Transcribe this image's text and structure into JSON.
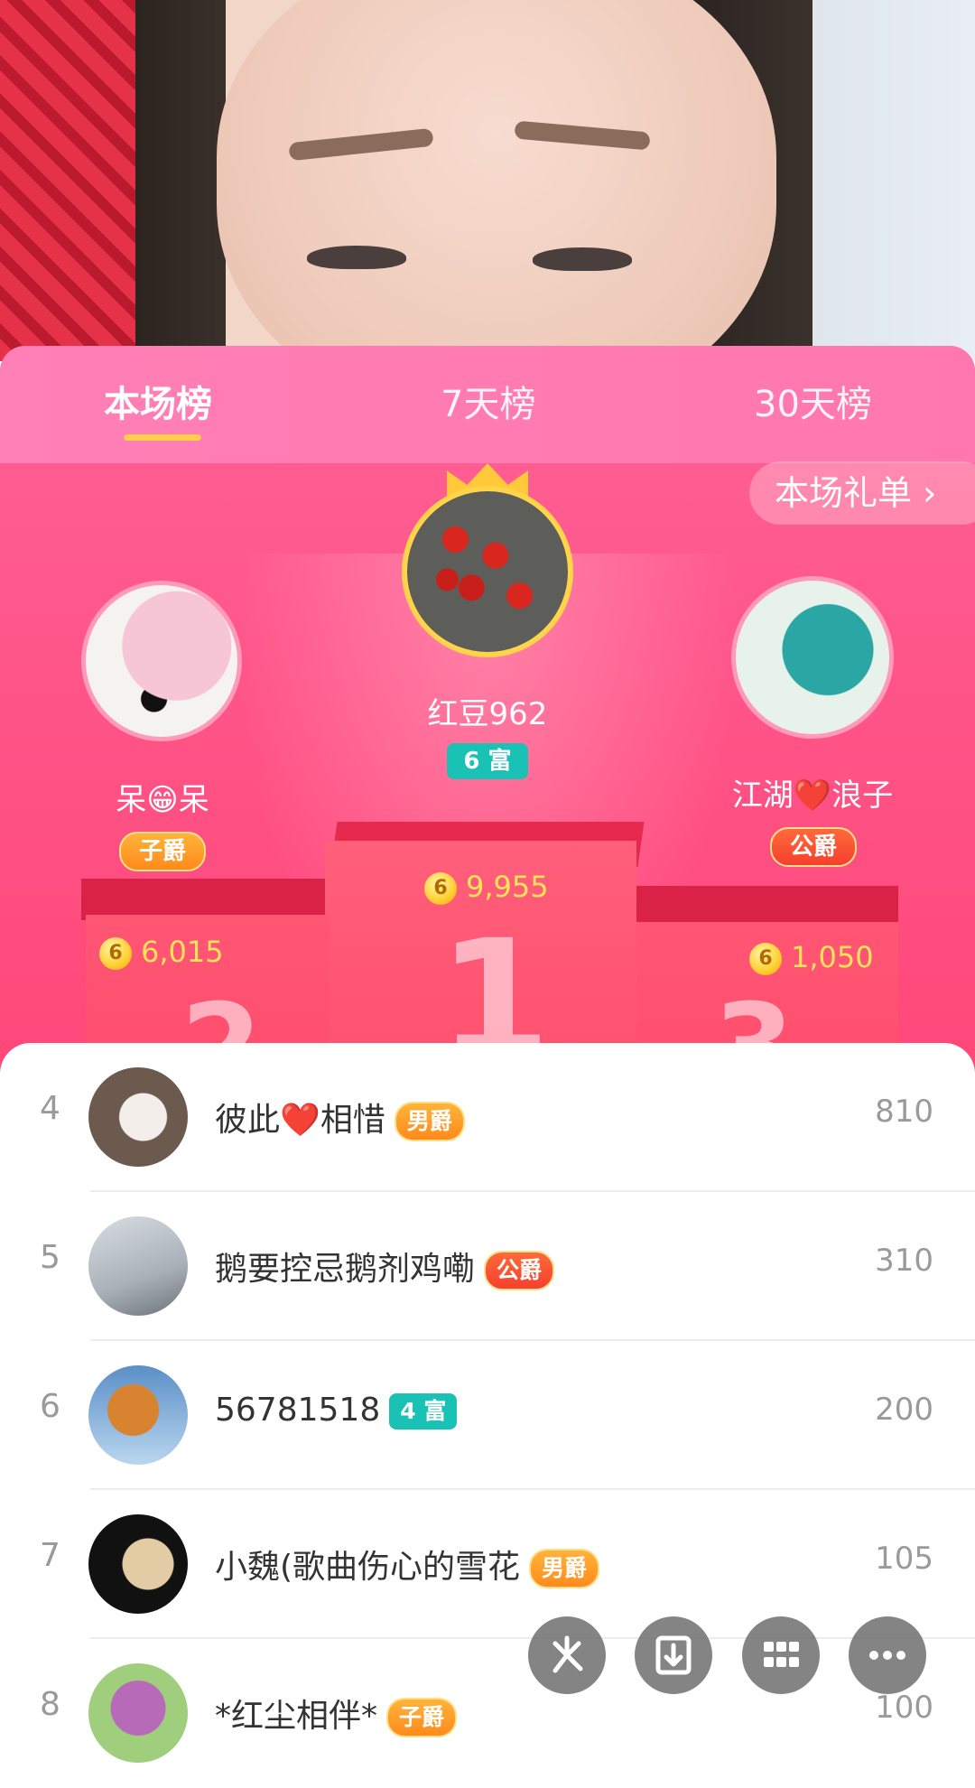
{
  "tabs": [
    {
      "label": "本场榜",
      "active": true
    },
    {
      "label": "7天榜",
      "active": false
    },
    {
      "label": "30天榜",
      "active": false
    }
  ],
  "gift_list_label": "本场礼单 ›",
  "top3": {
    "first": {
      "name": "红豆962",
      "badge": "6 富",
      "score": "9,955",
      "podium_number": "1"
    },
    "second": {
      "name": "呆😁呆",
      "badge": "子爵",
      "score": "6,015",
      "podium_number": "2"
    },
    "third": {
      "name": "江湖❤️浪子",
      "badge": "公爵",
      "score": "1,050",
      "podium_number": "3"
    }
  },
  "coin_symbol": "6",
  "ranking": [
    {
      "rank": "4",
      "name": "彼此❤️相惜",
      "badge": "男爵",
      "badge_type": "noble",
      "score": "810"
    },
    {
      "rank": "5",
      "name": "鹅要控忌鹅剂鸡嘞",
      "badge": "公爵",
      "badge_type": "noble-red",
      "score": "310"
    },
    {
      "rank": "6",
      "name": "56781518",
      "badge": "4 富",
      "badge_type": "rich",
      "score": "200"
    },
    {
      "rank": "7",
      "name": "小魏(歌曲伤心的雪花",
      "badge": "男爵",
      "badge_type": "noble",
      "score": "105"
    },
    {
      "rank": "8",
      "name": "*红尘相伴*",
      "badge": "子爵",
      "badge_type": "noble",
      "score": "100"
    }
  ],
  "fab_icons": [
    "pinwheel-icon",
    "download-icon",
    "grid-icon",
    "more-icon"
  ],
  "colors": {
    "accent": "#ff4f82",
    "rich_badge": "#19c2b5",
    "coin": "#ffd23a",
    "score_yellow": "#ffe35a"
  }
}
